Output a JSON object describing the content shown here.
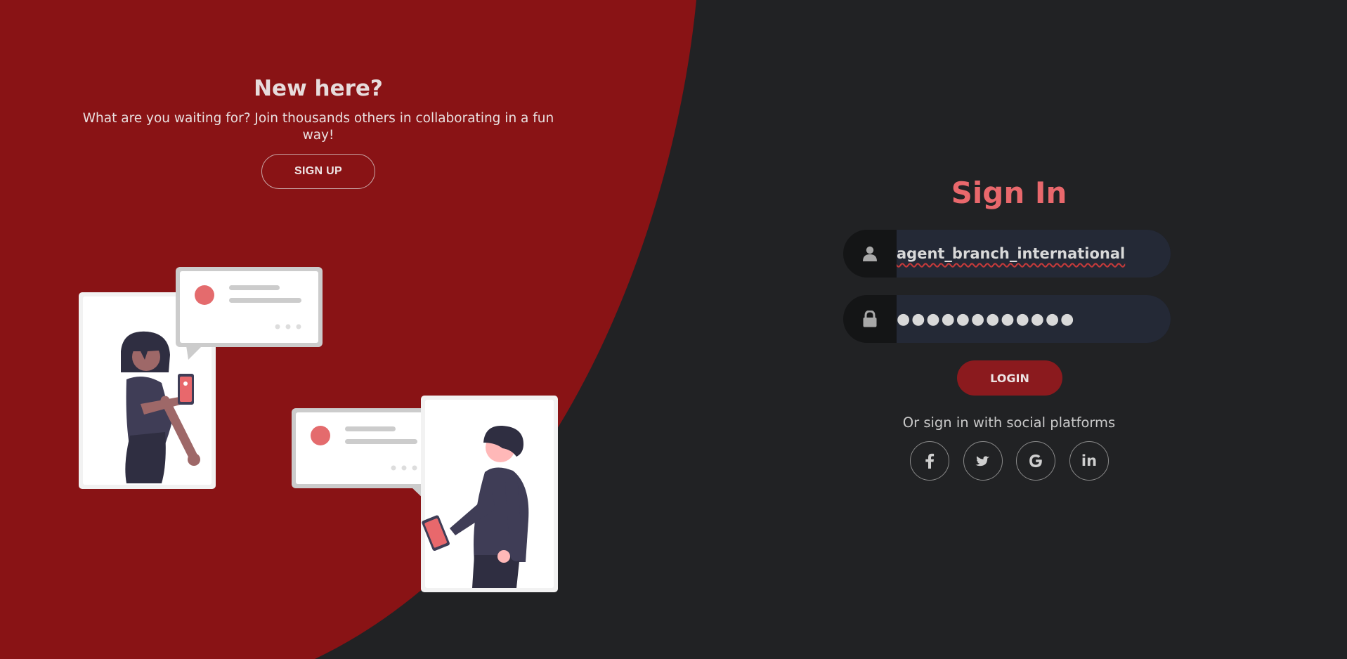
{
  "colors": {
    "panel_red": "#891315",
    "background": "#212224",
    "accent": "#e9686c",
    "login_button": "#8b1a1e",
    "input_bg": "#242936"
  },
  "left_panel": {
    "title": "New here?",
    "text": "What are you waiting for? Join thousands others in collaborating in a fun way!",
    "signup_label": "SIGN UP"
  },
  "sign_in": {
    "title": "Sign In",
    "username": {
      "icon": "user-icon",
      "value": "agent_branch_international"
    },
    "password": {
      "icon": "lock-icon",
      "masked_value": "●●●●●●●●●●●●"
    },
    "login_label": "LOGIN",
    "social_text": "Or sign in with social platforms",
    "social_icons": [
      "facebook-icon",
      "twitter-icon",
      "google-icon",
      "linkedin-icon"
    ]
  }
}
